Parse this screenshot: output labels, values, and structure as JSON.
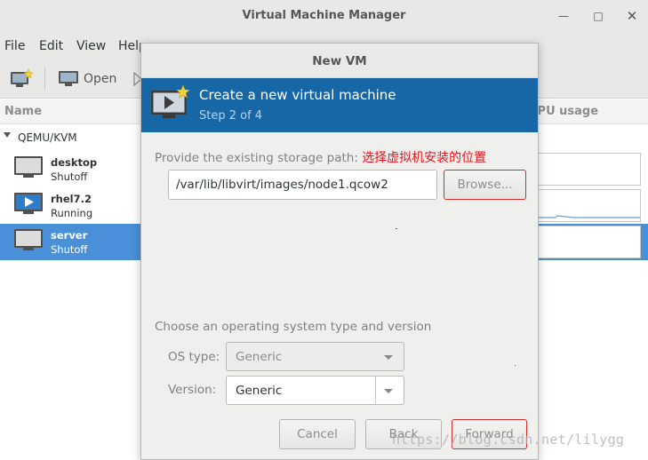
{
  "window": {
    "title": "Virtual Machine Manager"
  },
  "menu": [
    "File",
    "Edit",
    "View",
    "Help"
  ],
  "toolbar": {
    "open_label": "Open"
  },
  "columns": {
    "name": "Name",
    "cpu": "CPU usage"
  },
  "list": {
    "group": "QEMU/KVM",
    "vms": [
      {
        "name": "desktop",
        "state": "Shutoff"
      },
      {
        "name": "rhel7.2",
        "state": "Running"
      },
      {
        "name": "server",
        "state": "Shutoff"
      }
    ]
  },
  "dialog": {
    "title": "New VM",
    "header_title": "Create a new virtual machine",
    "header_step": "Step 2 of 4",
    "storage_label": "Provide the existing storage path:",
    "storage_annotation": "选择虚拟机安装的位置",
    "storage_path": "/var/lib/libvirt/images/node1.qcow2",
    "browse_label": "Browse...",
    "os_section_label": "Choose an operating system type and version",
    "os_type_label": "OS type:",
    "os_type_value": "Generic",
    "version_label": "Version:",
    "version_value": "Generic",
    "cancel_label": "Cancel",
    "back_label": "Back",
    "forward_label": "Forward"
  },
  "watermark": "https://blog.csdn.net/lilygg",
  "colors": {
    "header_blue": "#1766a5",
    "selection_blue": "#4a90d9",
    "annotation_red": "#e8151c"
  }
}
